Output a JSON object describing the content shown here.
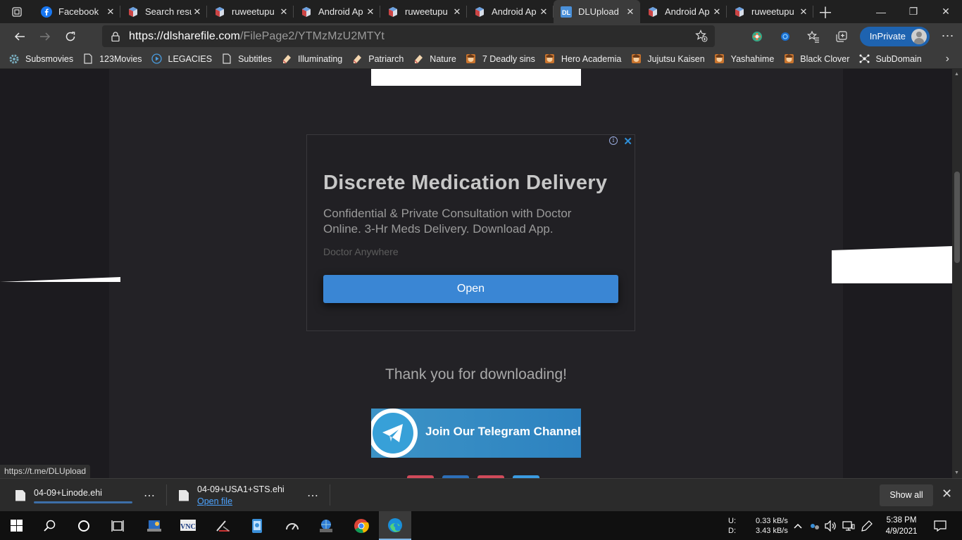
{
  "browser": {
    "tabs": [
      {
        "label": "Facebook",
        "icon": "facebook-icon",
        "active": false
      },
      {
        "label": "Search resu",
        "icon": "cube-icon",
        "active": false
      },
      {
        "label": "ruweetupu",
        "icon": "cube-icon",
        "active": false
      },
      {
        "label": "Android Ap",
        "icon": "cube-icon",
        "active": false
      },
      {
        "label": "ruweetupu",
        "icon": "cube-icon",
        "active": false
      },
      {
        "label": "Android Ap",
        "icon": "cube-icon",
        "active": false
      },
      {
        "label": "DLUpload",
        "icon": "dl-icon",
        "active": true
      },
      {
        "label": "Android Ap",
        "icon": "cube-icon",
        "active": false
      },
      {
        "label": "ruweetupu",
        "icon": "cube-icon",
        "active": false
      }
    ],
    "url_host": "https://dlsharefile.com",
    "url_path": "/FilePage2/YTMzMzU2MTYt",
    "inprivate_label": "InPrivate",
    "favorites": [
      {
        "label": "Subsmovies",
        "icon": "gear-icon"
      },
      {
        "label": "123Movies",
        "icon": "page-icon"
      },
      {
        "label": "LEGACIES",
        "icon": "play-circle-icon"
      },
      {
        "label": "Subtitles",
        "icon": "page-icon"
      },
      {
        "label": "Illuminating",
        "icon": "pencil-icon"
      },
      {
        "label": "Patriarch",
        "icon": "pencil-icon"
      },
      {
        "label": "Nature",
        "icon": "pencil-icon"
      },
      {
        "label": "7 Deadly sins",
        "icon": "anime-icon"
      },
      {
        "label": "Hero Academia",
        "icon": "anime-icon"
      },
      {
        "label": "Jujutsu Kaisen",
        "icon": "anime-icon"
      },
      {
        "label": "Yashahime",
        "icon": "anime-icon"
      },
      {
        "label": "Black Clover",
        "icon": "anime-icon"
      },
      {
        "label": "SubDomain",
        "icon": "network-icon"
      }
    ]
  },
  "ad": {
    "headline": "Discrete Medication Delivery",
    "body": "Confidential & Private Consultation with Doctor Online. 3-Hr Meds Delivery. Download App.",
    "advertiser": "Doctor Anywhere",
    "cta": "Open"
  },
  "page": {
    "thanks": "Thank you for downloading!",
    "telegram_label": "Join Our Telegram Channel",
    "status_url": "https://t.me/DLUpload"
  },
  "downloads": [
    {
      "name": "04-09+Linode.ehi",
      "status": ""
    },
    {
      "name": "04-09+USA1+STS.ehi",
      "status": "Open file"
    }
  ],
  "downloads_show_all": "Show all",
  "taskbar": {
    "net_up_label": "U:",
    "net_down_label": "D:",
    "net_up": "0.33 kB/s",
    "net_down": "3.43 kB/s",
    "time": "5:38 PM",
    "date": "4/9/2021"
  },
  "colors": {
    "accent": "#3a86d4",
    "inprivate": "#1e63b0",
    "page_bg": "#1c1b1f"
  }
}
